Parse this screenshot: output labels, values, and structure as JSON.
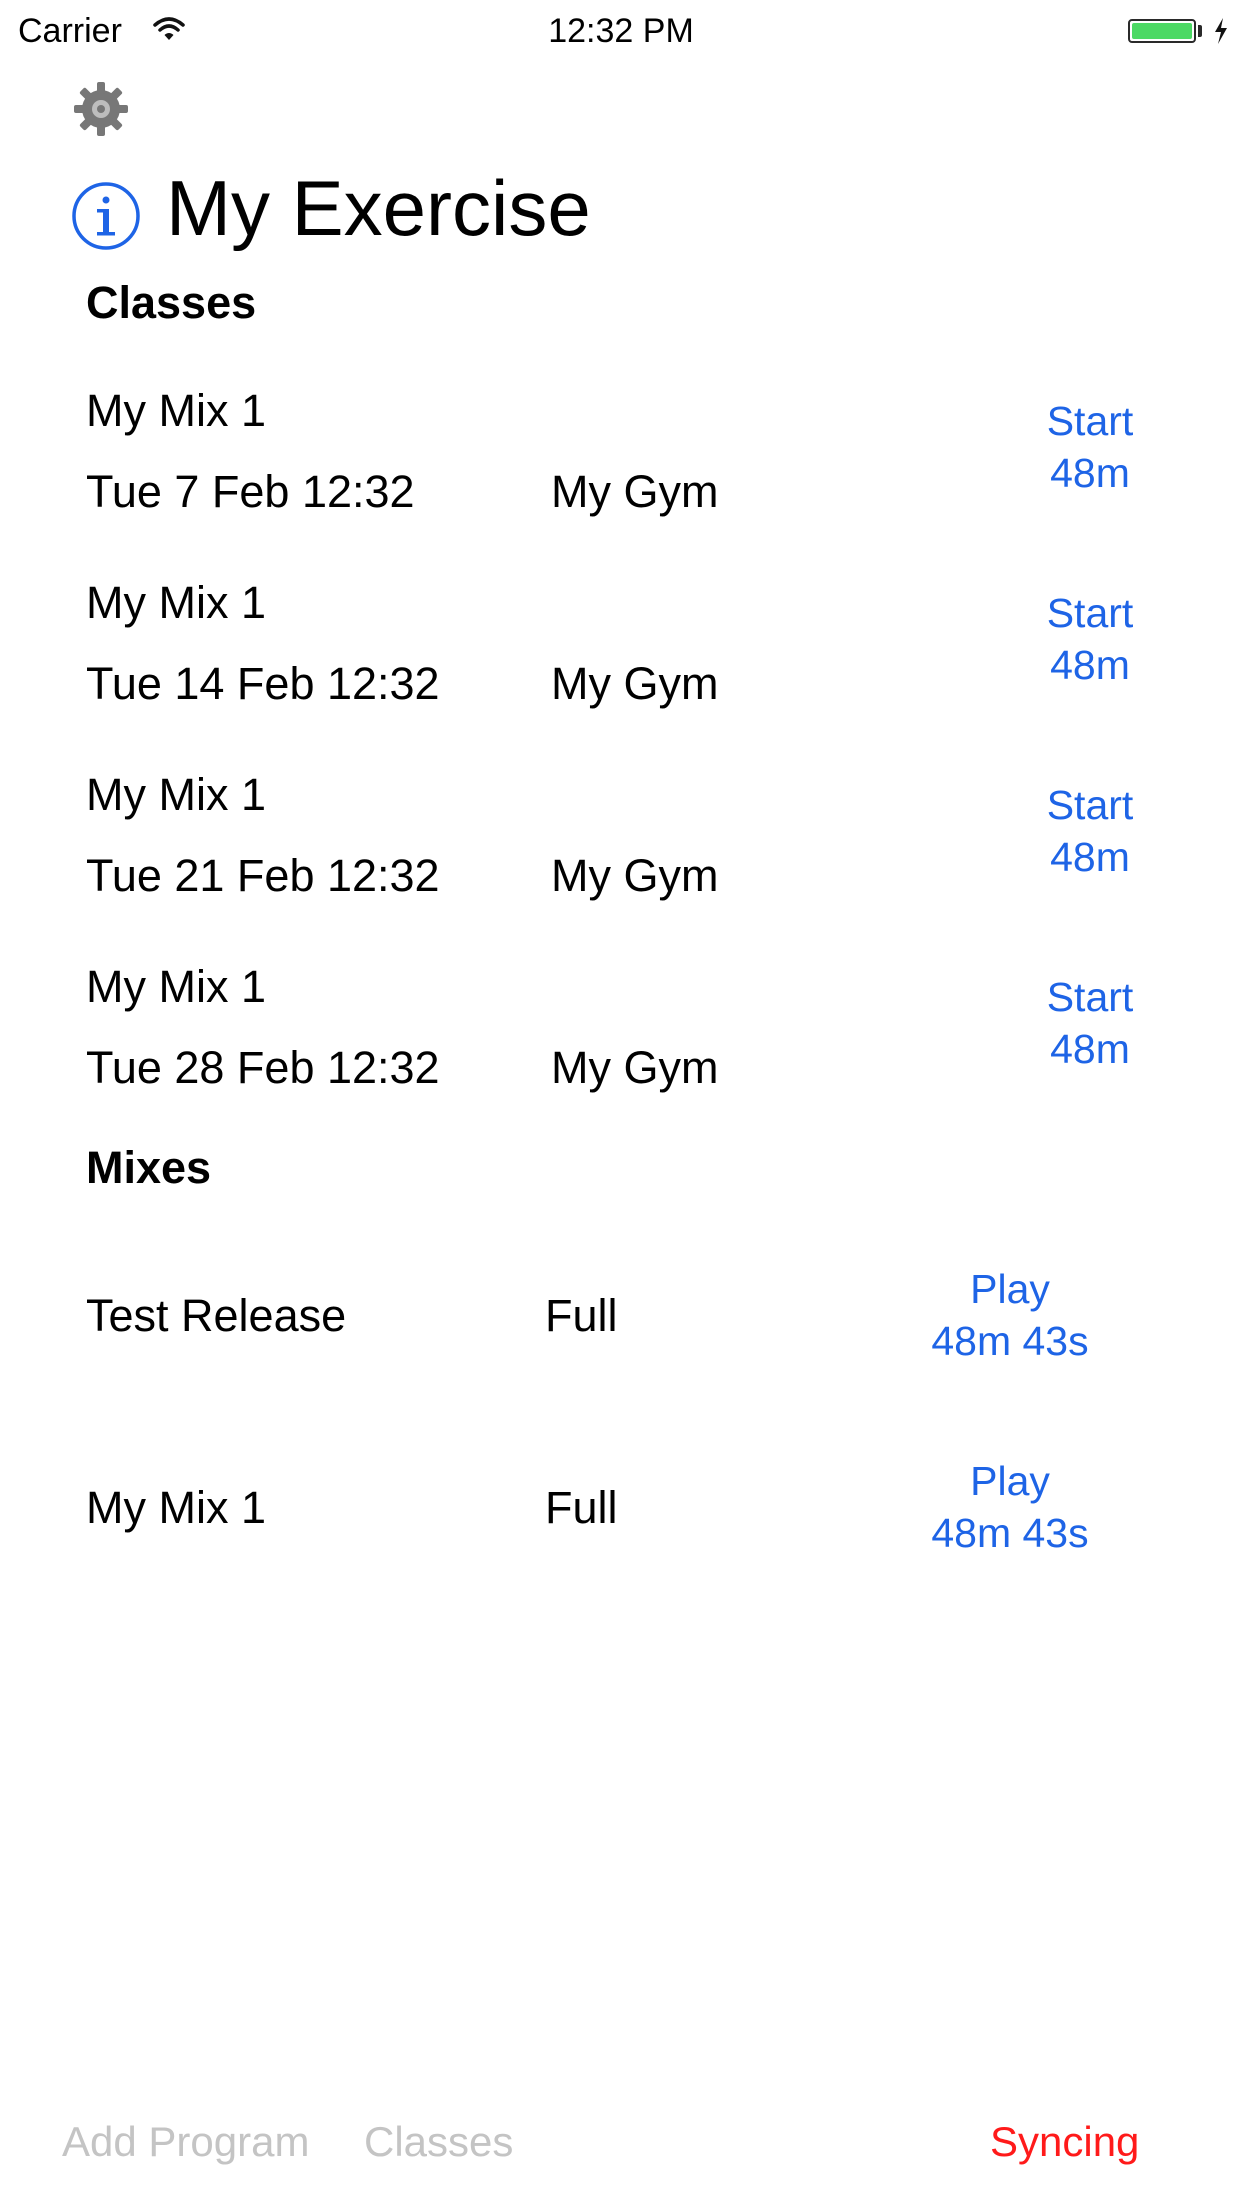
{
  "status_bar": {
    "carrier": "Carrier",
    "time": "12:32 PM",
    "battery_color": "#4cd964"
  },
  "header": {
    "settings_icon": "gear-icon",
    "info_icon": "info-icon",
    "title": "My Exercise"
  },
  "classes": {
    "heading": "Classes",
    "items": [
      {
        "name": "My Mix 1",
        "datetime": "Tue 7 Feb 12:32",
        "location": "My Gym",
        "action": "Start",
        "duration": "48m"
      },
      {
        "name": "My Mix 1",
        "datetime": "Tue 14 Feb 12:32",
        "location": "My Gym",
        "action": "Start",
        "duration": "48m"
      },
      {
        "name": "My Mix 1",
        "datetime": "Tue 21 Feb 12:32",
        "location": "My Gym",
        "action": "Start",
        "duration": "48m"
      },
      {
        "name": "My Mix 1",
        "datetime": "Tue 28 Feb 12:32",
        "location": "My Gym",
        "action": "Start",
        "duration": "48m"
      }
    ]
  },
  "mixes": {
    "heading": "Mixes",
    "items": [
      {
        "name": "Test Release",
        "type": "Full",
        "action": "Play",
        "duration": "48m 43s"
      },
      {
        "name": "My Mix 1",
        "type": "Full",
        "action": "Play",
        "duration": "48m 43s"
      }
    ]
  },
  "bottom_bar": {
    "add_program": "Add Program",
    "classes": "Classes",
    "syncing": "Syncing"
  },
  "colors": {
    "accent": "#1e64e6",
    "syncing": "#ff1a1a",
    "disabled": "#c4c4c4"
  }
}
